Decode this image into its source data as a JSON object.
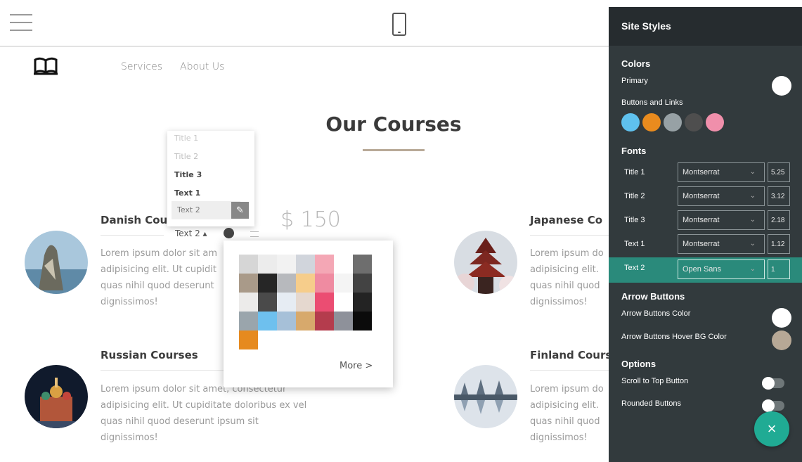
{
  "nav": {
    "links": [
      "Services",
      "About Us"
    ]
  },
  "section": {
    "title": "Our Courses"
  },
  "courses": [
    {
      "title": "Danish Cou",
      "text": [
        "Lorem ipsum dolor sit am",
        "adipisicing elit. Ut cupidit",
        "quas nihil quod deserunt",
        "dignissimos!"
      ]
    },
    {
      "title": "Japanese Co",
      "text": [
        "Lorem ipsum do",
        "adipisicing elit.",
        "quas nihil quod",
        "dignissimos!"
      ]
    },
    {
      "title": "Russian Courses",
      "text": [
        "Lorem ipsum dolor sit amet, consectetur",
        "adipisicing elit. Ut cupiditate doloribus ex vel",
        "quas nihil quod deserunt ipsum sit",
        "dignissimos!"
      ]
    },
    {
      "title": "Finland Cours",
      "text": [
        "Lorem ipsum do",
        "adipisicing elit.",
        "quas nihil quod",
        "dignissimos!"
      ]
    }
  ],
  "price": "$ 150",
  "text_styles": {
    "items": [
      "Title 1",
      "Title 2",
      "Title 3",
      "Text 1",
      "Text 2"
    ],
    "current": "Text 2"
  },
  "color_picker": {
    "more_label": "More >",
    "swatches": [
      [
        "#d6d6d6",
        "#ececec",
        "#f2f2f2",
        "#d1d5dc",
        "#f4a7b5",
        "#ffffff",
        "#6e6e6e"
      ],
      [
        "#a99a89",
        "#262626",
        "#b7b9bd",
        "#f6cd8b",
        "#ef8ba1",
        "#f4f4f4",
        "#434343"
      ],
      [
        "#ecebea",
        "#4a4a4a",
        "#e6ecf3",
        "#e5d8cf",
        "#eb4d72",
        "#ffffff",
        "#232323"
      ],
      [
        "#9aa5ac",
        "#6ec0ee",
        "#a6c0d8",
        "#d7a96c",
        "#b43c4d",
        "#8e919a",
        "#0b0b0b"
      ],
      [
        "#e68a1f"
      ]
    ]
  },
  "panel": {
    "title": "Site Styles",
    "colors_heading": "Colors",
    "primary_label": "Primary",
    "primary_color": "#ffffff",
    "buttons_links_label": "Buttons and Links",
    "buttons_links_colors": [
      "#5fc1ee",
      "#e98b1e",
      "#97a1a5",
      "#4e4e4e",
      "#f08fab"
    ],
    "fonts_heading": "Fonts",
    "fonts": [
      {
        "label": "Title 1",
        "family": "Montserrat",
        "size": "5.25"
      },
      {
        "label": "Title 2",
        "family": "Montserrat",
        "size": "3.12"
      },
      {
        "label": "Title 3",
        "family": "Montserrat",
        "size": "2.18"
      },
      {
        "label": "Text 1",
        "family": "Montserrat",
        "size": "1.12"
      },
      {
        "label": "Text 2",
        "family": "Open Sans",
        "size": "1"
      }
    ],
    "arrow_heading": "Arrow Buttons",
    "arrow_color_label": "Arrow Buttons Color",
    "arrow_color": "#ffffff",
    "arrow_hover_label": "Arrow Buttons Hover BG Color",
    "arrow_hover_color": "#b7a896",
    "options_heading": "Options",
    "scroll_top_label": "Scroll to Top Button",
    "rounded_label": "Rounded Buttons",
    "fab_icon": "×"
  }
}
